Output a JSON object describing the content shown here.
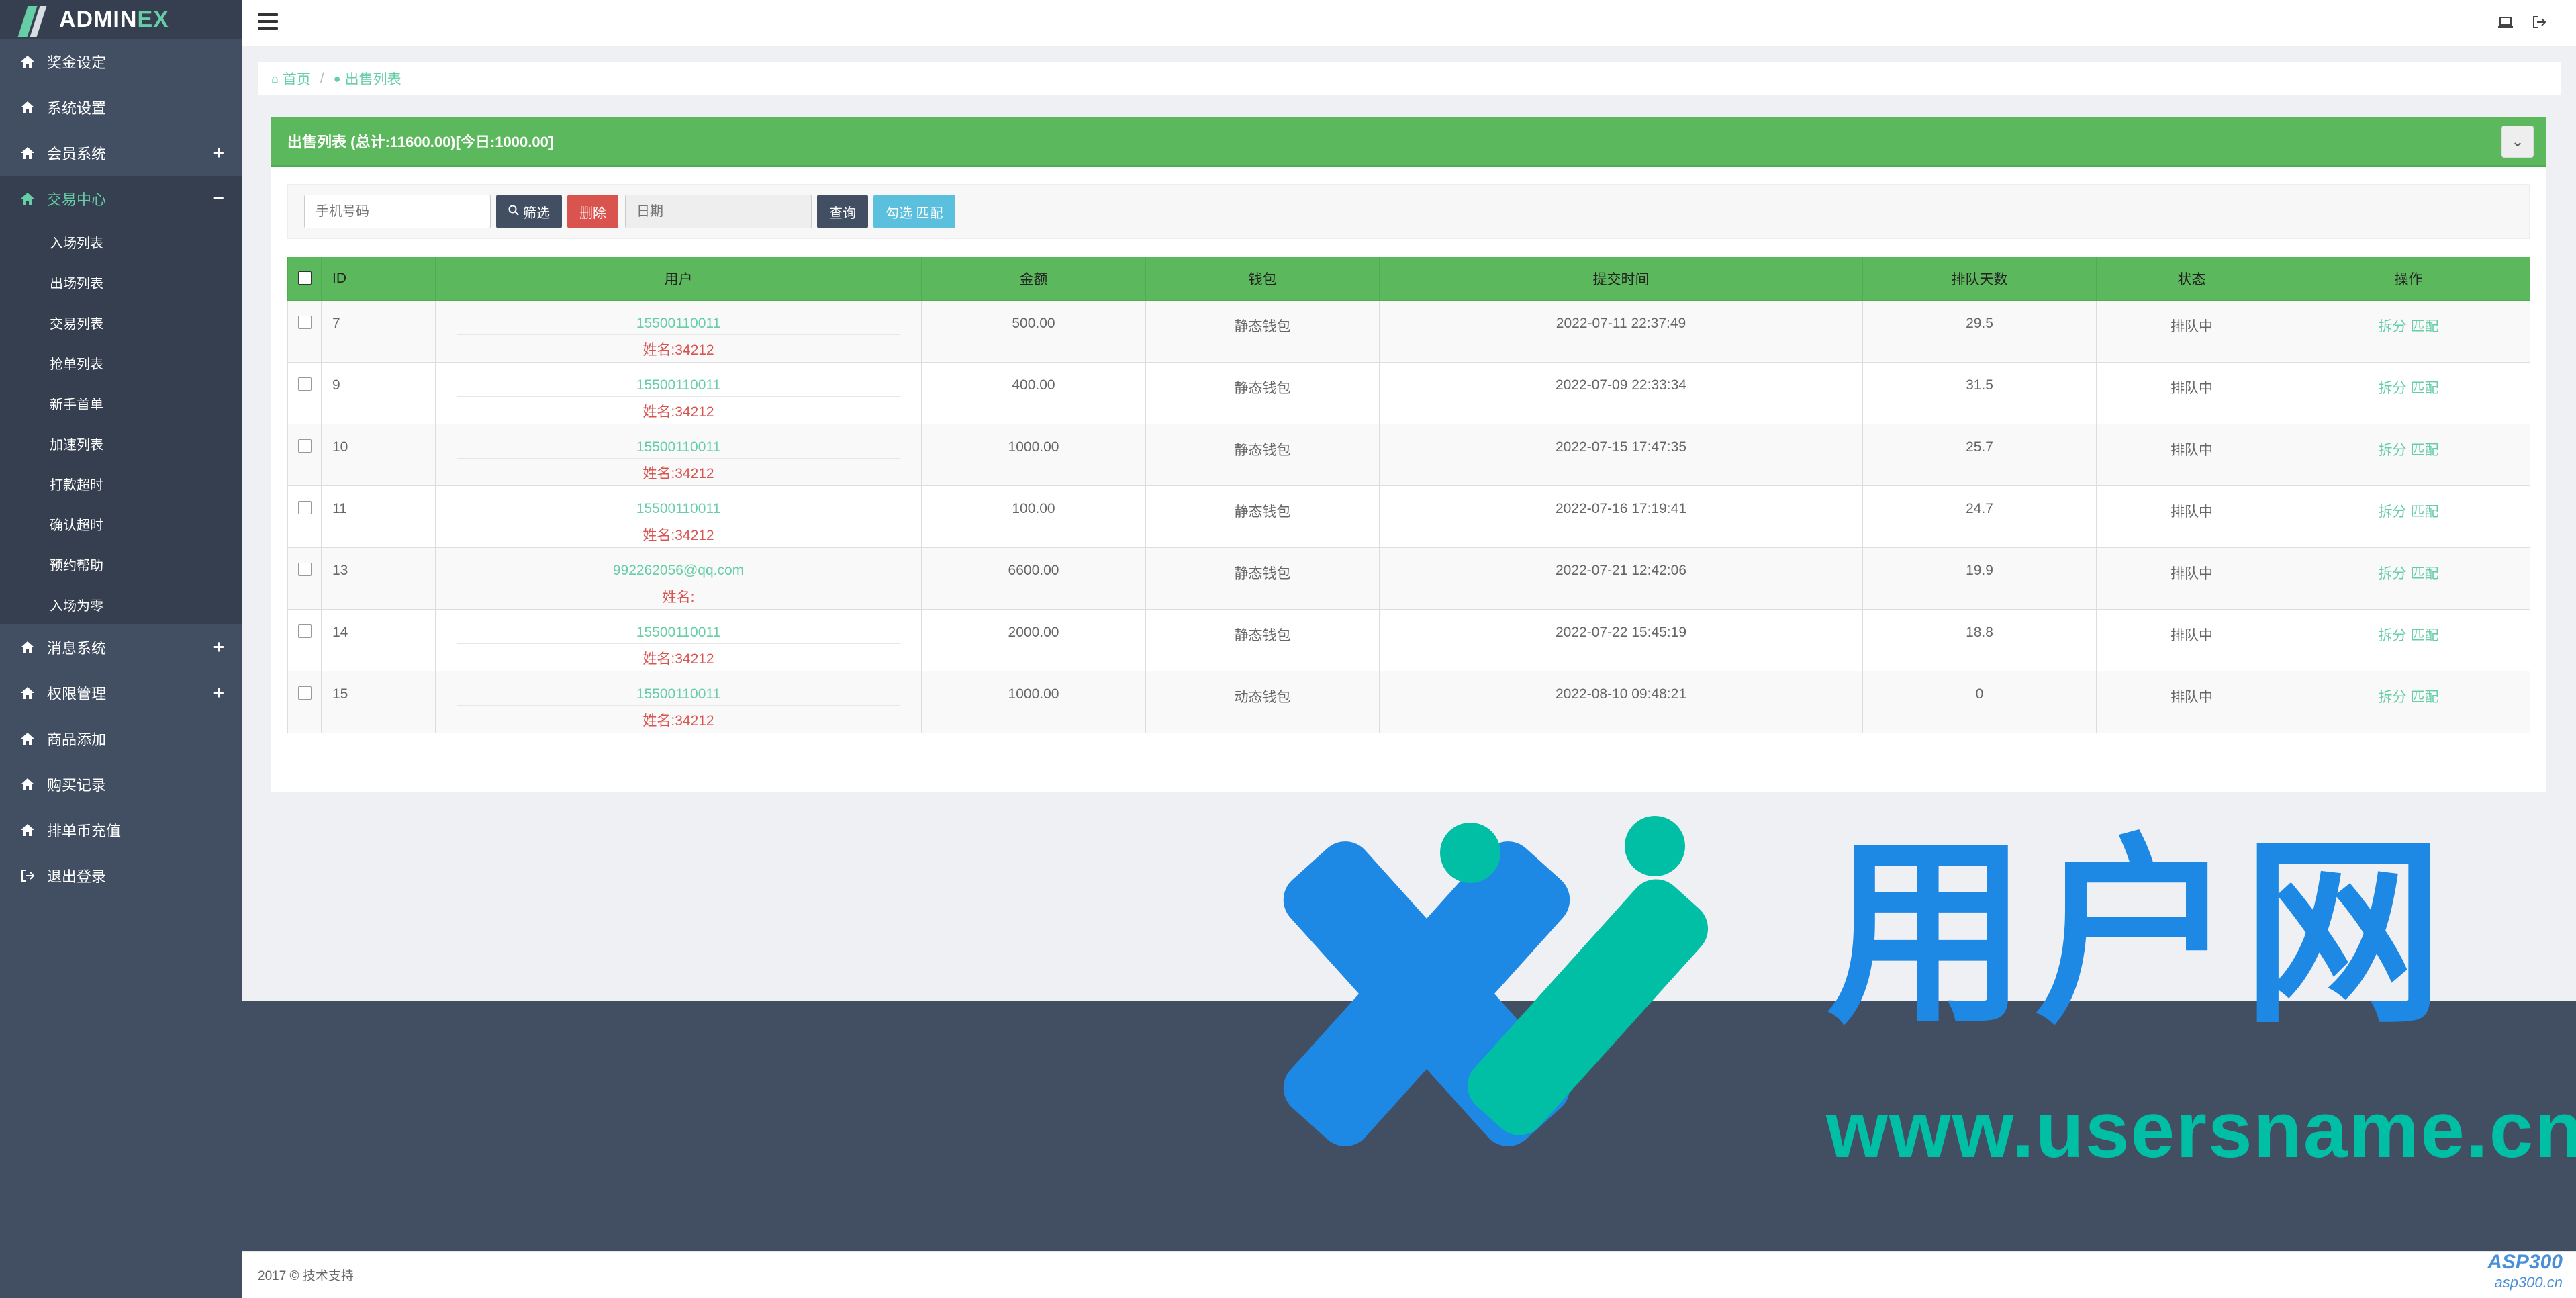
{
  "brand": {
    "prefix": "ADMIN",
    "suffix": "EX"
  },
  "sidebar": {
    "items": [
      {
        "label": "奖金设定",
        "icon": "home-icon",
        "expandable": false
      },
      {
        "label": "系统设置",
        "icon": "home-icon",
        "expandable": false
      },
      {
        "label": "会员系统",
        "icon": "home-icon",
        "expandable": true,
        "toggle": "+"
      },
      {
        "label": "交易中心",
        "icon": "home-icon",
        "expandable": true,
        "toggle": "−",
        "active": true
      },
      {
        "label": "消息系统",
        "icon": "home-icon",
        "expandable": true,
        "toggle": "+"
      },
      {
        "label": "权限管理",
        "icon": "home-icon",
        "expandable": true,
        "toggle": "+"
      },
      {
        "label": "商品添加",
        "icon": "home-icon",
        "expandable": false
      },
      {
        "label": "购买记录",
        "icon": "home-icon",
        "expandable": false
      },
      {
        "label": "排单币充值",
        "icon": "home-icon",
        "expandable": false
      },
      {
        "label": "退出登录",
        "icon": "sign-out-icon",
        "expandable": false
      }
    ],
    "submenu": [
      "入场列表",
      "出场列表",
      "交易列表",
      "抢单列表",
      "新手首单",
      "加速列表",
      "打款超时",
      "确认超时",
      "预约帮助",
      "入场为零"
    ]
  },
  "breadcrumb": {
    "home": "首页",
    "current": "出售列表"
  },
  "panel": {
    "title": "出售列表 (总计:11600.00)[今日:1000.00]"
  },
  "toolbar": {
    "phone_placeholder": "手机号码",
    "filter_label": "筛选",
    "delete_label": "删除",
    "date_placeholder": "日期",
    "query_label": "查询",
    "match_label": "勾选 匹配"
  },
  "table": {
    "headers": [
      "ID",
      "用户",
      "金额",
      "钱包",
      "提交时间",
      "排队天数",
      "状态",
      "操作"
    ],
    "rows": [
      {
        "id": "7",
        "phone": "15500110011",
        "name": "姓名:34212",
        "amount": "500.00",
        "wallet": "静态钱包",
        "wallet_type": "static",
        "time": "2022-07-11 22:37:49",
        "days": "29.5",
        "status": "排队中",
        "op1": "拆分",
        "op2": "匹配"
      },
      {
        "id": "9",
        "phone": "15500110011",
        "name": "姓名:34212",
        "amount": "400.00",
        "wallet": "静态钱包",
        "wallet_type": "static",
        "time": "2022-07-09 22:33:34",
        "days": "31.5",
        "status": "排队中",
        "op1": "拆分",
        "op2": "匹配"
      },
      {
        "id": "10",
        "phone": "15500110011",
        "name": "姓名:34212",
        "amount": "1000.00",
        "wallet": "静态钱包",
        "wallet_type": "static",
        "time": "2022-07-15 17:47:35",
        "days": "25.7",
        "status": "排队中",
        "op1": "拆分",
        "op2": "匹配"
      },
      {
        "id": "11",
        "phone": "15500110011",
        "name": "姓名:34212",
        "amount": "100.00",
        "wallet": "静态钱包",
        "wallet_type": "static",
        "time": "2022-07-16 17:19:41",
        "days": "24.7",
        "status": "排队中",
        "op1": "拆分",
        "op2": "匹配"
      },
      {
        "id": "13",
        "phone": "992262056@qq.com",
        "name": "姓名:",
        "amount": "6600.00",
        "wallet": "静态钱包",
        "wallet_type": "static",
        "time": "2022-07-21 12:42:06",
        "days": "19.9",
        "status": "排队中",
        "op1": "拆分",
        "op2": "匹配"
      },
      {
        "id": "14",
        "phone": "15500110011",
        "name": "姓名:34212",
        "amount": "2000.00",
        "wallet": "静态钱包",
        "wallet_type": "static",
        "time": "2022-07-22 15:45:19",
        "days": "18.8",
        "status": "排队中",
        "op1": "拆分",
        "op2": "匹配"
      },
      {
        "id": "15",
        "phone": "15500110011",
        "name": "姓名:34212",
        "amount": "1000.00",
        "wallet": "动态钱包",
        "wallet_type": "dynamic",
        "time": "2022-08-10 09:48:21",
        "days": "0",
        "status": "排队中",
        "op1": "拆分",
        "op2": "匹配"
      }
    ]
  },
  "footer": {
    "text": "2017 © 技术支持"
  },
  "watermark": {
    "cn": "用户网",
    "url": "www.usersname.cn",
    "badge_top": "ASP300",
    "badge_bottom": "asp300.cn"
  },
  "colors": {
    "sidebar": "#424f63",
    "accent": "#65cea7",
    "success": "#5cb85c",
    "danger": "#d9534f",
    "info": "#5bc0de"
  }
}
